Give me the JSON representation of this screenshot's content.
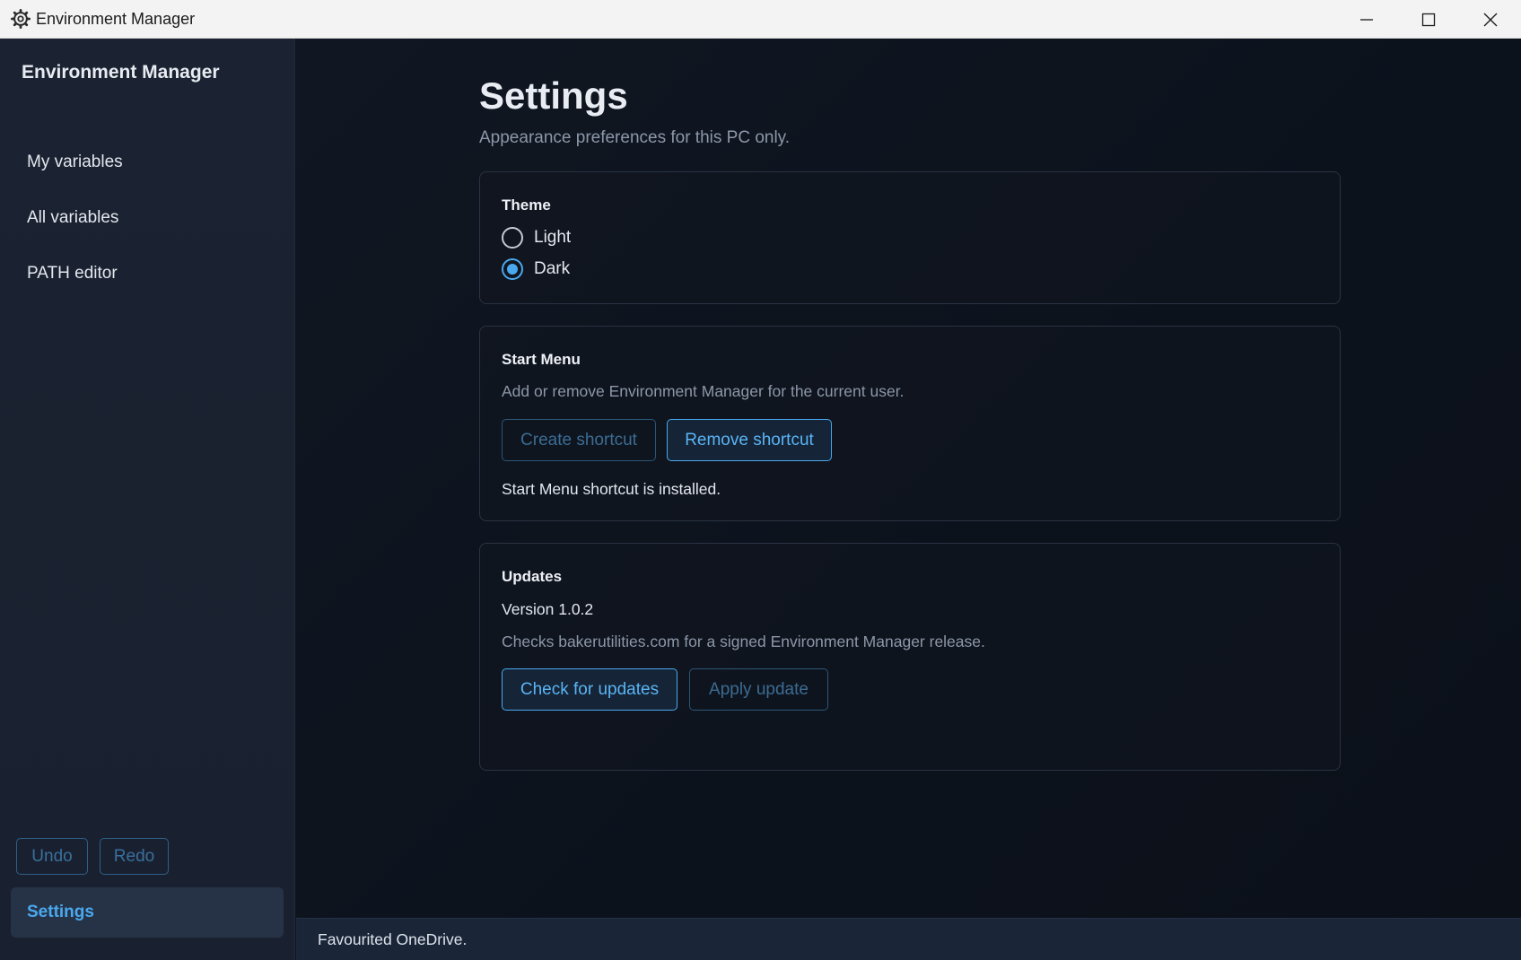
{
  "window": {
    "title": "Environment Manager",
    "controls": {
      "minimize": "minimize-icon",
      "maximize": "maximize-icon",
      "close": "close-icon"
    }
  },
  "sidebar": {
    "title": "Environment Manager",
    "items": [
      {
        "label": "My variables"
      },
      {
        "label": "All variables"
      },
      {
        "label": "PATH editor"
      }
    ],
    "undo_label": "Undo",
    "redo_label": "Redo",
    "settings_label": "Settings",
    "active_item": "Settings"
  },
  "main": {
    "title": "Settings",
    "subtitle": "Appearance preferences for this PC only.",
    "theme": {
      "heading": "Theme",
      "options": [
        {
          "label": "Light",
          "checked": false
        },
        {
          "label": "Dark",
          "checked": true
        }
      ]
    },
    "start_menu": {
      "heading": "Start Menu",
      "description": "Add or remove Environment Manager for the current user.",
      "create_label": "Create shortcut",
      "remove_label": "Remove shortcut",
      "status": "Start Menu shortcut is installed."
    },
    "updates": {
      "heading": "Updates",
      "version": "Version 1.0.2",
      "description": "Checks bakerutilities.com for a signed Environment Manager release.",
      "check_label": "Check for updates",
      "apply_label": "Apply update"
    }
  },
  "statusbar": {
    "message": "Favourited OneDrive."
  },
  "colors": {
    "accent": "#4aa8ee",
    "sidebar_bg": "#1b2231",
    "main_bg": "#0d131e",
    "statusbar_bg": "#1a2638"
  }
}
